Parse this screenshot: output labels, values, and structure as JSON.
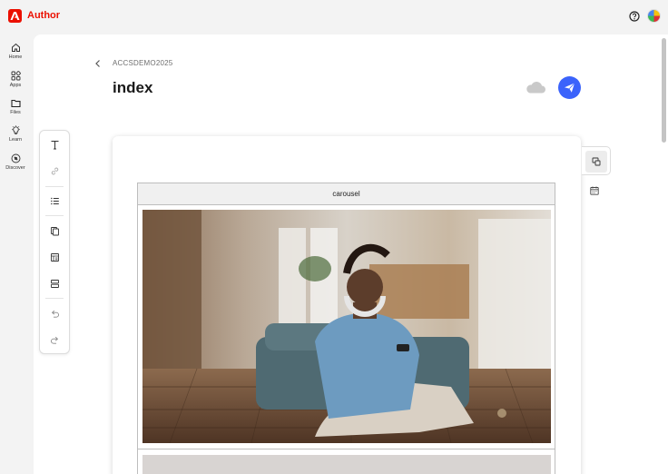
{
  "app": {
    "name": "Author"
  },
  "nav": {
    "items": [
      {
        "label": "Home",
        "icon": "home-icon"
      },
      {
        "label": "Apps",
        "icon": "apps-icon"
      },
      {
        "label": "Files",
        "icon": "folder-icon"
      },
      {
        "label": "Learn",
        "icon": "lightbulb-icon"
      },
      {
        "label": "Discover",
        "icon": "compass-icon"
      }
    ]
  },
  "header": {
    "breadcrumb": "ACCSDEMO2025",
    "title": "index"
  },
  "toolbar": {
    "tools": [
      "text-icon",
      "link-icon",
      "list-icon",
      "copy-icon",
      "block-icon",
      "section-icon",
      "undo-icon",
      "redo-icon"
    ]
  },
  "canvas": {
    "component_label": "carousel"
  },
  "colors": {
    "brand": "#eb1000",
    "accent": "#3b63fb"
  }
}
